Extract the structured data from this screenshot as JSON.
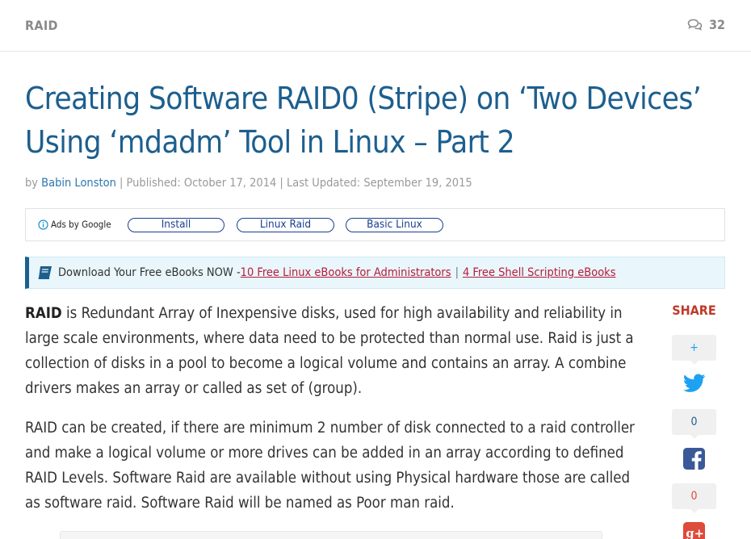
{
  "topbar": {
    "category": "RAID",
    "comments_count": "32",
    "comment_icon": "comment-bubbles-icon"
  },
  "article": {
    "title": "Creating Software RAID0 (Stripe) on ‘Two Devices’ Using ‘mdadm’ Tool in Linux – Part 2",
    "meta": {
      "by": "by",
      "author": "Babin Lonston",
      "published": " | Published: October 17, 2014 | Last Updated: September 19, 2015"
    },
    "paragraphs": [
      {
        "lead": "RAID",
        "text": " is Redundant Array of Inexpensive disks, used for high availability and reliability in large scale environments, where data need to be protected than normal use. Raid is just a collection of disks in a pool to become a logical volume and contains an array. A combine drivers makes an array or called as set of (group)."
      },
      {
        "text": "RAID can be created, if there are minimum 2 number of disk connected to a raid controller and make a logical volume or more drives can be added in an array according to defined RAID Levels. Software Raid are available without using Physical hardware those are called as software raid. Software Raid will be named as Poor man raid."
      }
    ]
  },
  "ads": {
    "ads_by": "Ads by Google",
    "info_icon": "info-icon",
    "pills": [
      "Install",
      "Linux Raid",
      "Basic Linux"
    ]
  },
  "ebook": {
    "icon": "book-icon",
    "text": "Download Your Free eBooks NOW - ",
    "link1": "10 Free Linux eBooks for Administrators",
    "separator": "|",
    "link2": "4 Free Shell Scripting eBooks"
  },
  "share": {
    "label": "SHARE",
    "plus": "+",
    "twitter_count": "0",
    "facebook_count": "0",
    "colors": {
      "twitter": "#1da1f2",
      "facebook": "#3b5998",
      "googleplus": "#dd4b39",
      "share_label": "#c0392b"
    }
  },
  "colors": {
    "title": "#1c5f8e",
    "link": "#2a77b0",
    "ebook_link": "#b71c3a",
    "ebook_bg": "#e9f6fb"
  }
}
